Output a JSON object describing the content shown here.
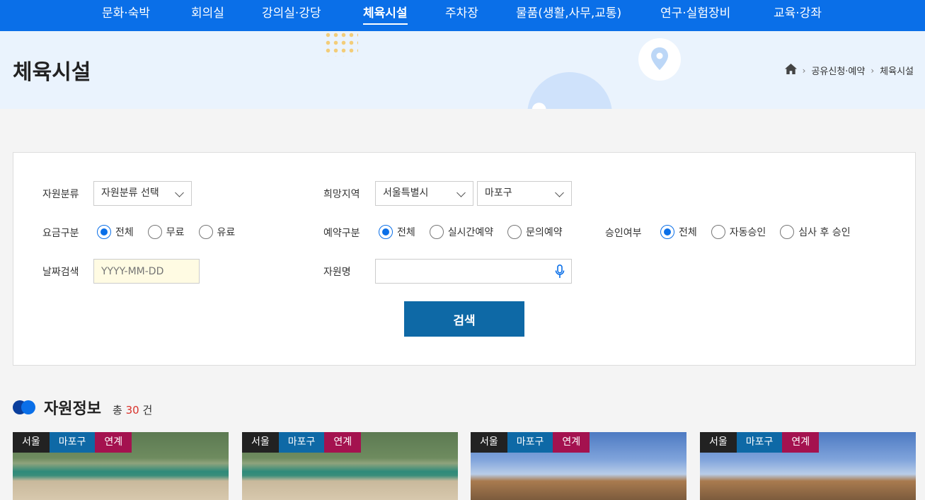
{
  "nav": {
    "items": [
      {
        "label": "문화·숙박",
        "active": false
      },
      {
        "label": "회의실",
        "active": false
      },
      {
        "label": "강의실·강당",
        "active": false
      },
      {
        "label": "체육시설",
        "active": true
      },
      {
        "label": "주차장",
        "active": false
      },
      {
        "label": "물품(생활,사무,교통)",
        "active": false
      },
      {
        "label": "연구·실험장비",
        "active": false
      },
      {
        "label": "교육·강좌",
        "active": false
      }
    ]
  },
  "hero": {
    "title": "체육시설",
    "breadcrumb": [
      "공유신청·예약",
      "체육시설"
    ]
  },
  "search": {
    "category_label": "자원분류",
    "category_value": "자원분류 선택",
    "region_label": "희망지역",
    "region_city": "서울특별시",
    "region_district": "마포구",
    "fee_label": "요금구분",
    "fee_options": [
      "전체",
      "무료",
      "유료"
    ],
    "reserve_label": "예약구분",
    "reserve_options": [
      "전체",
      "실시간예약",
      "문의예약"
    ],
    "approval_label": "승인여부",
    "approval_options": [
      "전체",
      "자동승인",
      "심사 후 승인"
    ],
    "date_label": "날짜검색",
    "date_placeholder": "YYYY-MM-DD",
    "name_label": "자원명",
    "name_value": "",
    "button": "검색"
  },
  "results": {
    "title": "자원정보",
    "count_prefix": "총",
    "count": "30",
    "count_suffix": "건",
    "cards": [
      {
        "city": "서울",
        "district": "마포구",
        "tag": "연계"
      },
      {
        "city": "서울",
        "district": "마포구",
        "tag": "연계"
      },
      {
        "city": "서울",
        "district": "마포구",
        "tag": "연계"
      },
      {
        "city": "서울",
        "district": "마포구",
        "tag": "연계"
      }
    ]
  },
  "colors": {
    "nav_bg": "#0a6fe8",
    "button_bg": "#0e69a6",
    "tag_district": "#0e69a6",
    "tag_link": "#a4124f",
    "count_highlight": "#d9322b"
  }
}
